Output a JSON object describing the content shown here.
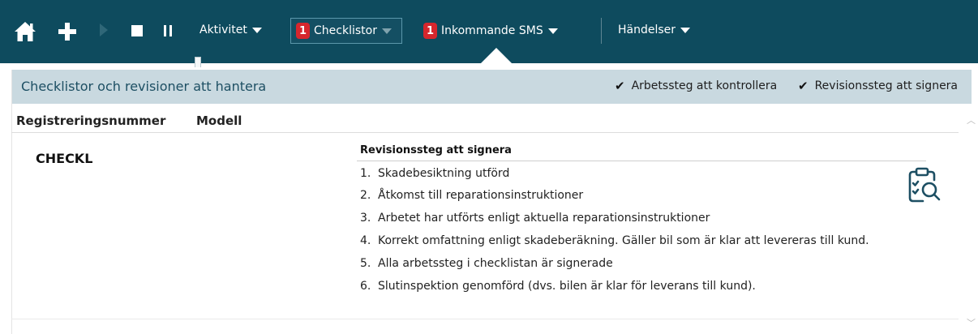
{
  "toolbar": {
    "aktivitet_label": "Aktivitet",
    "checklistor": {
      "label": "Checklistor",
      "badge": "1"
    },
    "inkommande_sms": {
      "label": "Inkommande SMS",
      "badge": "1"
    },
    "handelser_label": "Händelser",
    "icons": [
      "home-icon",
      "plus-icon",
      "play-icon",
      "stop-icon",
      "pause-icon"
    ]
  },
  "panel": {
    "title": "Checklistor och revisioner att hantera",
    "filters": [
      {
        "label": "Arbetssteg att kontrollera",
        "checked": true
      },
      {
        "label": "Revisionssteg att signera",
        "checked": true
      }
    ]
  },
  "table": {
    "columns": [
      "Registreringsnummer",
      "Modell"
    ],
    "rows": [
      {
        "registreringsnummer": "CHECKL",
        "modell": "",
        "steps_title": "Revisionssteg att signera",
        "steps": [
          {
            "num": "1.",
            "text": "Skadebesiktning utförd"
          },
          {
            "num": "2.",
            "text": "Åtkomst till reparationsinstruktioner"
          },
          {
            "num": "3.",
            "text": "Arbetet har utförts enligt aktuella reparationsinstruktioner"
          },
          {
            "num": "4.",
            "text": "Korrekt omfattning enligt skadeberäkning. Gäller bil som är klar att levereras till kund."
          },
          {
            "num": "5.",
            "text": "Alla arbetssteg i checklistan är signerade"
          },
          {
            "num": "6.",
            "text": "Slutinspektion genomförd (dvs. bilen är klar för leverans till kund)."
          }
        ],
        "action_icon": "clipboard-search-icon"
      }
    ]
  },
  "colors": {
    "toolbar_bg": "#0e4b5e",
    "panel_header_bg": "#c9d9e0",
    "panel_title": "#1d4f63",
    "badge": "#d6262d",
    "icon_accent": "#1d4f63"
  }
}
